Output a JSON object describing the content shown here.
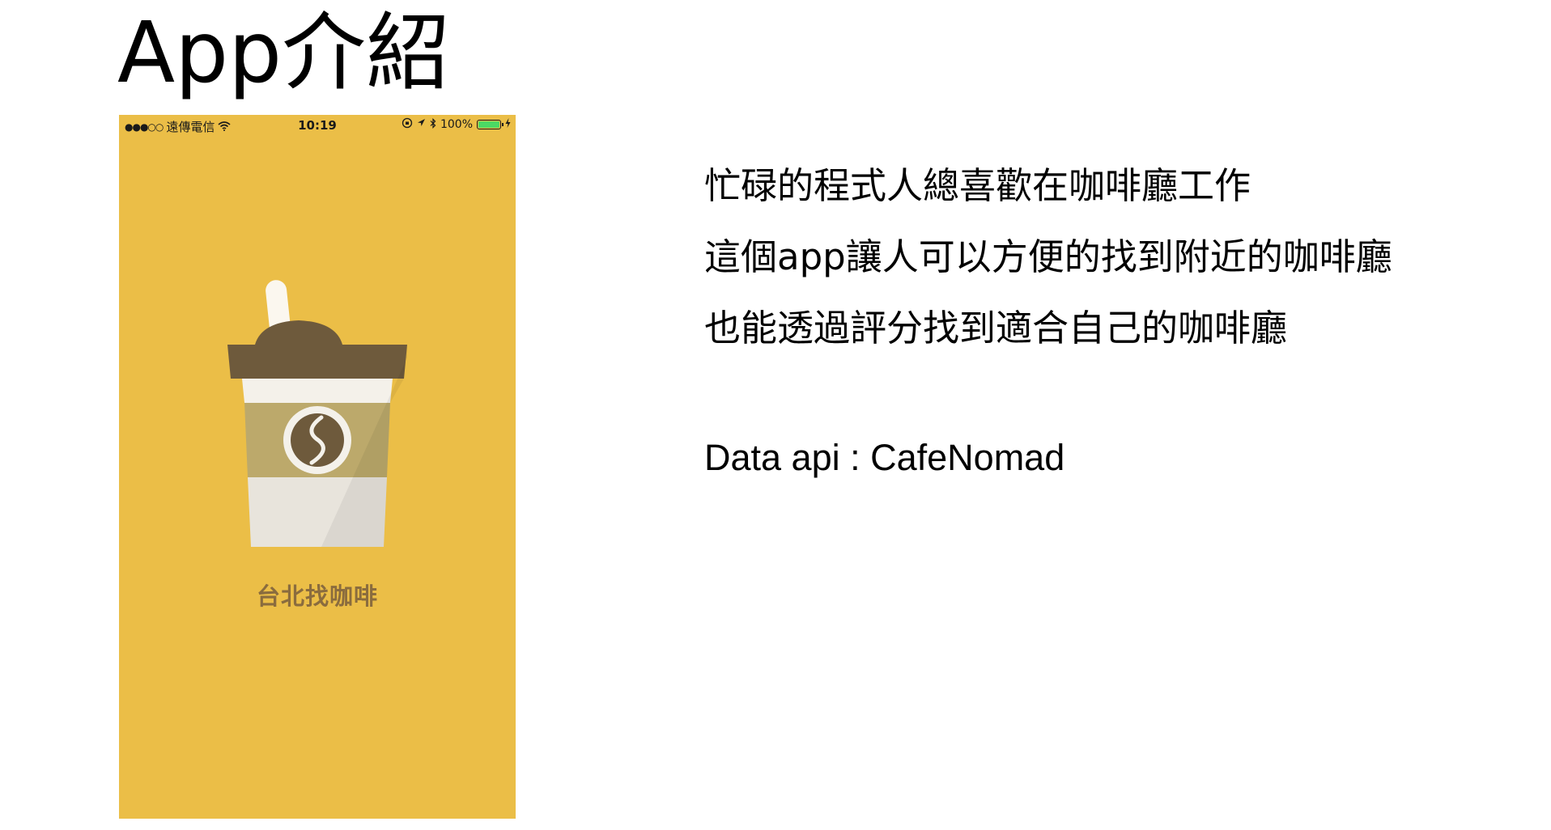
{
  "slide": {
    "title": "App介紹"
  },
  "phone": {
    "status_bar": {
      "signal": "●●●○○",
      "carrier": "遠傳電信",
      "wifi_icon": "wifi-icon",
      "time": "10:19",
      "battery_percent": "100%",
      "icons": [
        "orientation-lock-icon",
        "location-arrow-icon",
        "bluetooth-icon",
        "battery-icon",
        "charging-icon"
      ]
    },
    "app_name": "台北找咖啡",
    "colors": {
      "background": "#ebbe47",
      "lid": "#6e5a3c",
      "cup": "#e8e4dc",
      "band": "#bca96b",
      "app_name": "#8a6c3e"
    }
  },
  "description": {
    "lines": [
      "忙碌的程式人總喜歡在咖啡廳工作",
      "這個app讓人可以方便的找到附近的咖啡廳",
      "也能透過評分找到適合自己的咖啡廳"
    ],
    "api": "Data api : CafeNomad"
  }
}
